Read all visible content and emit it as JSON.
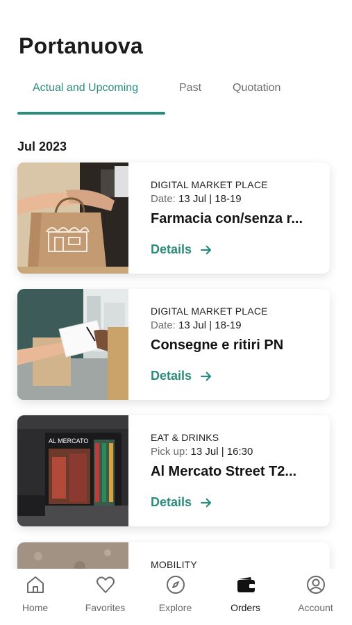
{
  "header": {
    "title": "Portanuova"
  },
  "tabs": [
    {
      "label": "Actual and Upcoming",
      "active": true
    },
    {
      "label": "Past",
      "active": false
    },
    {
      "label": "Quotation",
      "active": false
    }
  ],
  "month": "Jul 2023",
  "orders": [
    {
      "category": "DIGITAL MARKET PLACE",
      "date_label": "Date:",
      "date_value": "13 Jul | 18-19",
      "title": "Farmacia con/senza r...",
      "details": "Details",
      "image": "shopping-bag-handoff"
    },
    {
      "category": "DIGITAL MARKET PLACE",
      "date_label": "Date:",
      "date_value": "13 Jul | 18-19",
      "title": "Consegne e ritiri PN",
      "details": "Details",
      "image": "parcel-signing"
    },
    {
      "category": "EAT & DRINKS",
      "date_label": "Pick up:",
      "date_value": "13 Jul | 16:30",
      "title": "Al Mercato Street T2...",
      "details": "Details",
      "image": "restaurant-storefront",
      "storefront_sign": "AL MERCATO"
    },
    {
      "category": "MOBILITY",
      "image": "stone-texture"
    }
  ],
  "nav": [
    {
      "label": "Home",
      "icon": "home-icon",
      "active": false
    },
    {
      "label": "Favorites",
      "icon": "heart-icon",
      "active": false
    },
    {
      "label": "Explore",
      "icon": "compass-icon",
      "active": false
    },
    {
      "label": "Orders",
      "icon": "wallet-icon",
      "active": true
    },
    {
      "label": "Account",
      "icon": "user-circle-icon",
      "active": false
    }
  ],
  "colors": {
    "accent": "#2a8c7c",
    "text": "#1b1b1b",
    "muted": "#6b6b6b"
  }
}
